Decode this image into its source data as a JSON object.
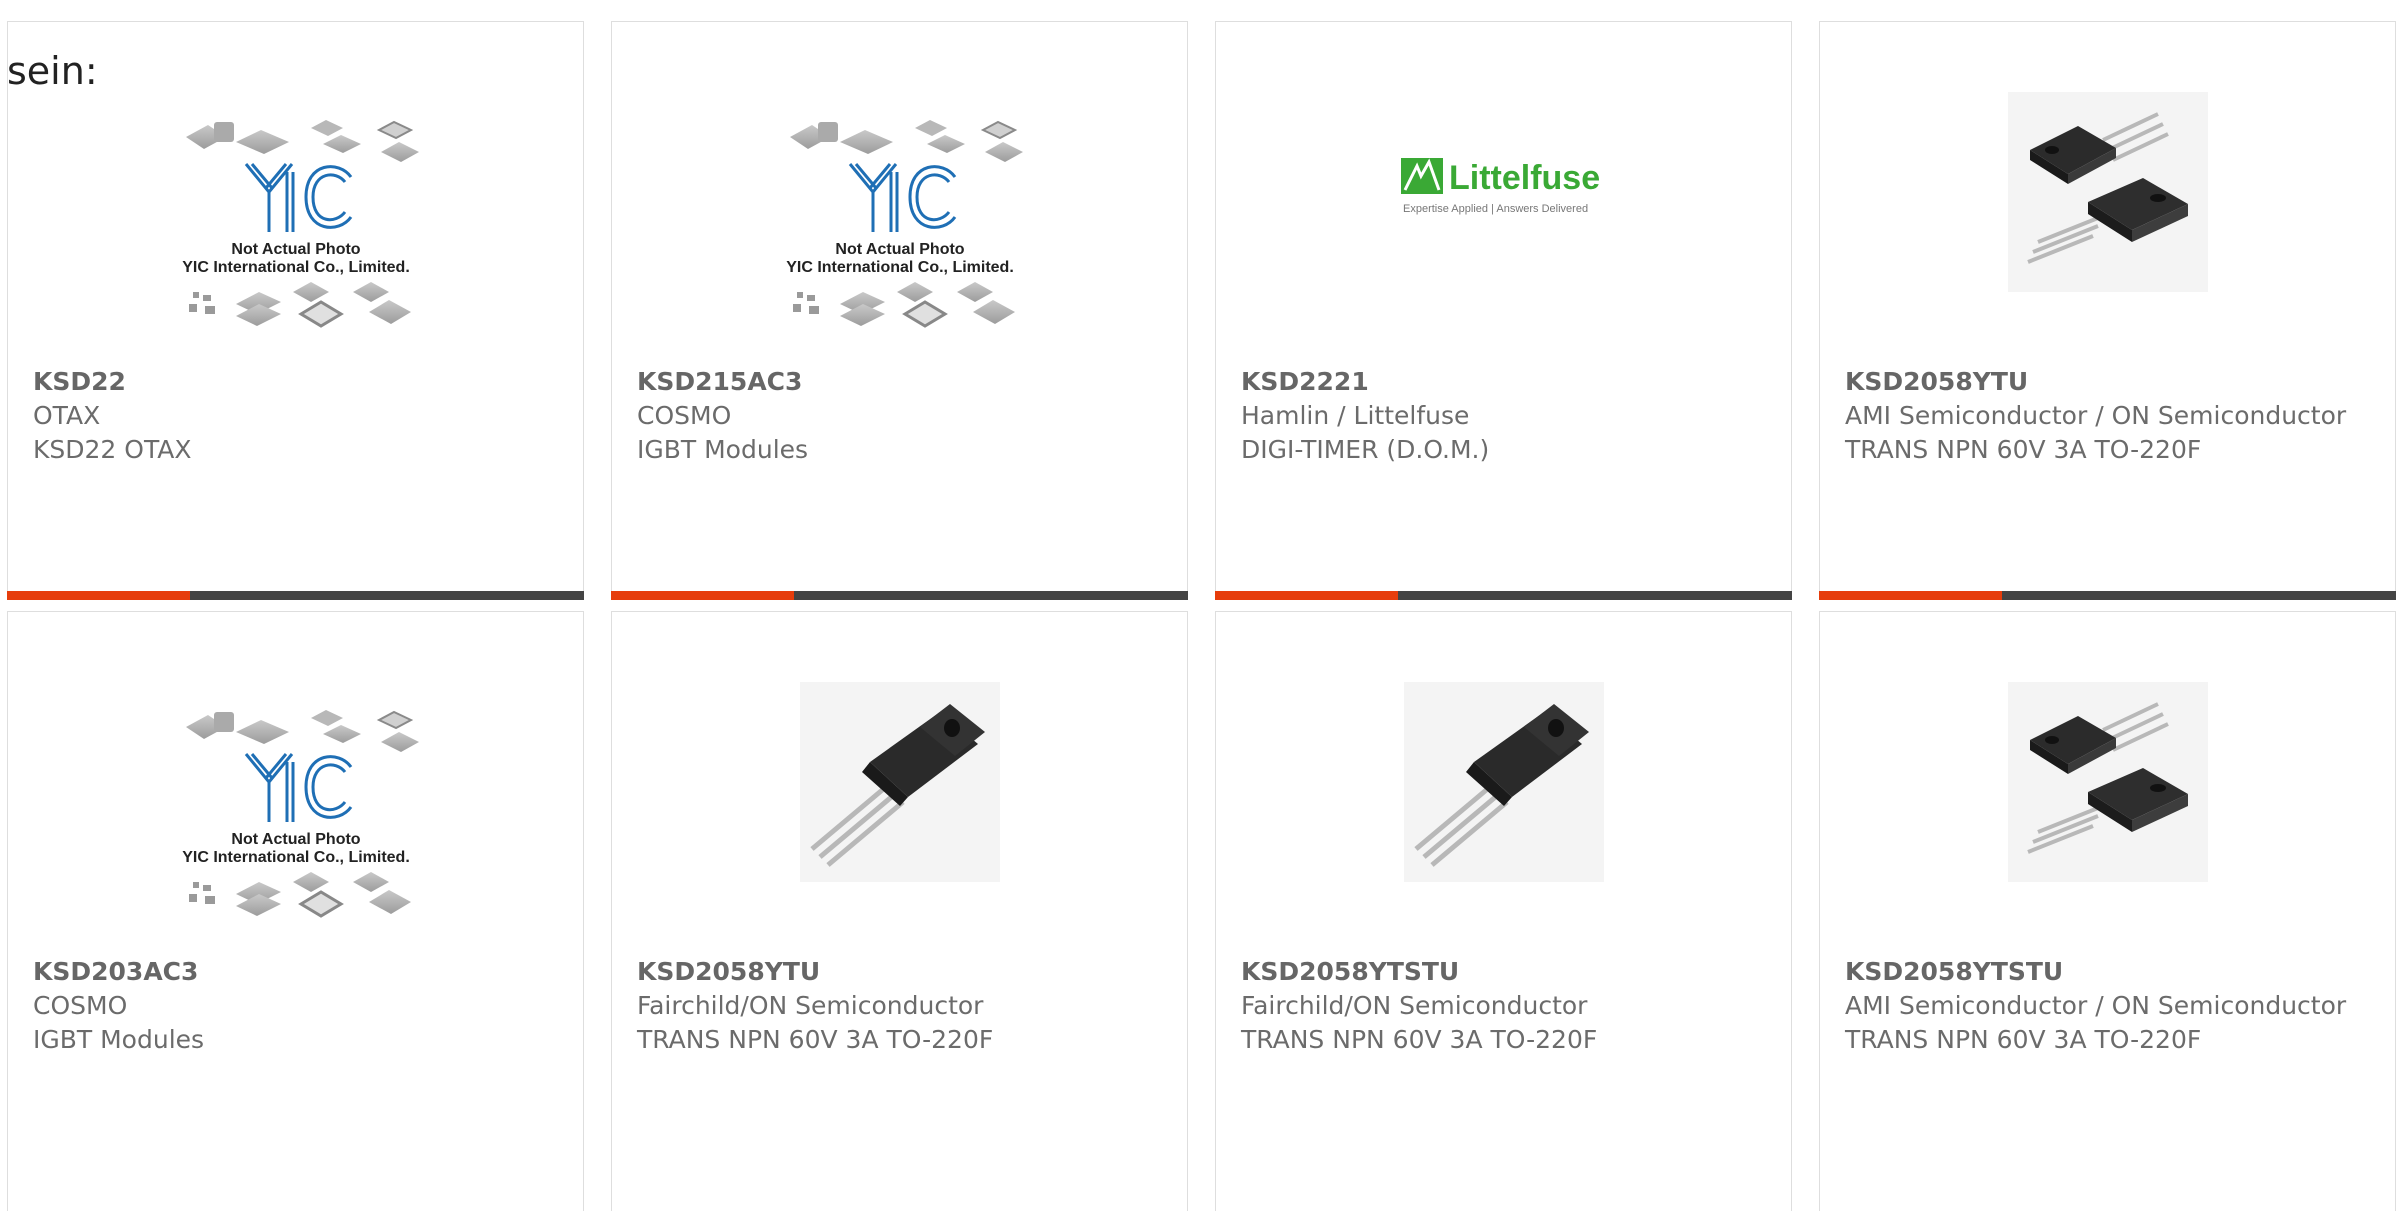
{
  "lead_text": "sein:",
  "colors": {
    "accent": "#e63d0c",
    "bar": "#444444",
    "border": "#dedede",
    "text": "#6b6b6b",
    "yic_blue": "#1f6fb5",
    "littelfuse_green": "#3aa935"
  },
  "placeholder": {
    "line1": "Not Actual Photo",
    "line2": "YIC International Co., Limited."
  },
  "littelfuse": {
    "name": "Littelfuse",
    "tagline": "Expertise Applied | Answers Delivered"
  },
  "products": [
    {
      "part": "KSD22",
      "brand": "OTAX",
      "desc": "KSD22 OTAX",
      "image": "yic-placeholder"
    },
    {
      "part": "KSD215AC3",
      "brand": "COSMO",
      "desc": "IGBT Modules",
      "image": "yic-placeholder"
    },
    {
      "part": "KSD2221",
      "brand": "Hamlin / Littelfuse",
      "desc": "DIGI-TIMER (D.O.M.)",
      "image": "littelfuse-logo"
    },
    {
      "part": "KSD2058YTU",
      "brand": "AMI Semiconductor / ON Semiconductor",
      "desc": "TRANS NPN 60V 3A TO-220F",
      "image": "to220-pair"
    },
    {
      "part": "KSD203AC3",
      "brand": "COSMO",
      "desc": "IGBT Modules",
      "image": "yic-placeholder"
    },
    {
      "part": "KSD2058YTU",
      "brand": "Fairchild/ON Semiconductor",
      "desc": "TRANS NPN 60V 3A TO-220F",
      "image": "to220-single"
    },
    {
      "part": "KSD2058YTSTU",
      "brand": "Fairchild/ON Semiconductor",
      "desc": "TRANS NPN 60V 3A TO-220F",
      "image": "to220-single"
    },
    {
      "part": "KSD2058YTSTU",
      "brand": "AMI Semiconductor / ON Semiconductor",
      "desc": "TRANS NPN 60V 3A TO-220F",
      "image": "to220-pair"
    }
  ]
}
